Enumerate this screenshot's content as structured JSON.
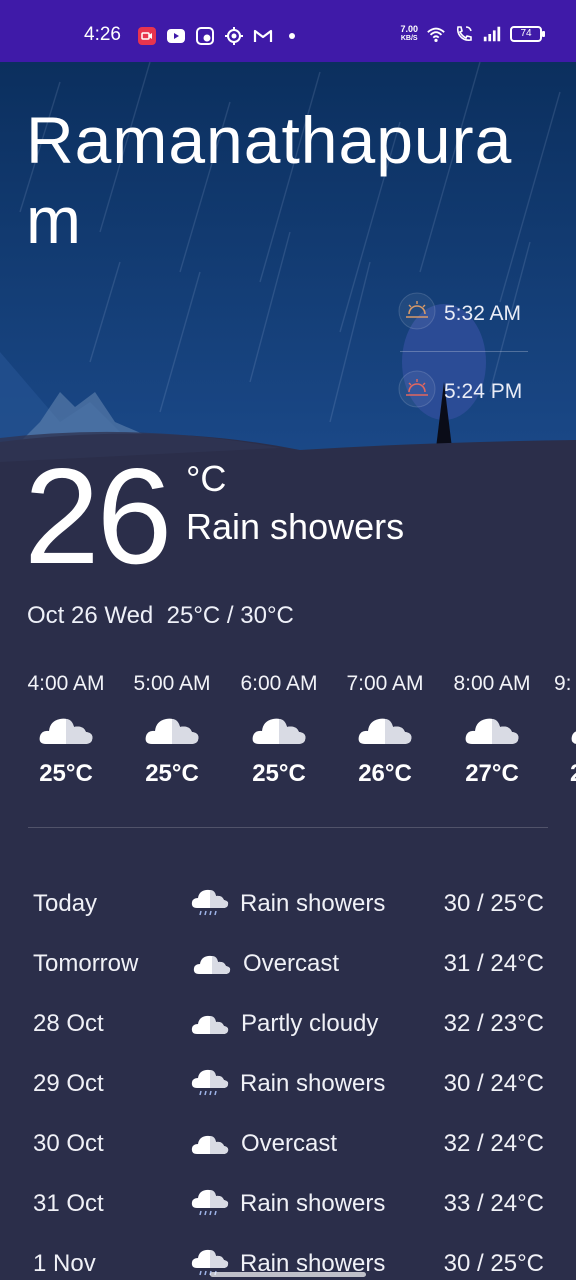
{
  "status_bar": {
    "time": "4:26",
    "net_speed_value": "7.00",
    "net_speed_unit": "KB/S",
    "battery": "74",
    "notification_icons": [
      "screen-record-icon",
      "youtube-icon",
      "camera-app-icon",
      "location-icon",
      "gmail-icon",
      "dot-icon"
    ],
    "system_icons": [
      "wifi-icon",
      "wifi-calling-icon",
      "signal-icon",
      "battery-icon"
    ]
  },
  "location": {
    "city": "Ramanathapuram"
  },
  "sun": {
    "sunrise": "5:32 AM",
    "sunset": "5:24 PM"
  },
  "current": {
    "temperature": "26",
    "unit": "°C",
    "condition": "Rain showers",
    "date": "Oct 26 Wed",
    "range": "25°C / 30°C"
  },
  "hourly": [
    {
      "time": "4:00 AM",
      "temp": "25°C",
      "icon": "cloud-icon"
    },
    {
      "time": "5:00 AM",
      "temp": "25°C",
      "icon": "cloud-icon"
    },
    {
      "time": "6:00 AM",
      "temp": "25°C",
      "icon": "cloud-icon"
    },
    {
      "time": "7:00 AM",
      "temp": "26°C",
      "icon": "cloud-icon"
    },
    {
      "time": "8:00 AM",
      "temp": "27°C",
      "icon": "cloud-icon"
    },
    {
      "time": "9:",
      "temp": "2",
      "icon": "cloud-icon"
    }
  ],
  "daily": [
    {
      "day": "Today",
      "condition": "Rain showers",
      "temps": "30 / 25°C",
      "icon": "rain-cloud-icon"
    },
    {
      "day": "Tomorrow",
      "condition": "Overcast",
      "temps": "31 / 24°C",
      "icon": "cloud-icon"
    },
    {
      "day": "28 Oct",
      "condition": "Partly cloudy",
      "temps": "32 / 23°C",
      "icon": "cloud-icon"
    },
    {
      "day": "29 Oct",
      "condition": "Rain showers",
      "temps": "30 / 24°C",
      "icon": "rain-cloud-icon"
    },
    {
      "day": "30 Oct",
      "condition": "Overcast",
      "temps": "32 / 24°C",
      "icon": "cloud-icon"
    },
    {
      "day": "31 Oct",
      "condition": "Rain showers",
      "temps": "33 / 24°C",
      "icon": "rain-cloud-icon"
    },
    {
      "day": "1 Nov",
      "condition": "Rain showers",
      "temps": "30 / 25°C",
      "icon": "rain-cloud-icon"
    }
  ],
  "colors": {
    "status_bar": "#3f1aa8",
    "sky_top": "#0b2f5e",
    "sky_bottom": "#1c4b8c",
    "ground": "#2b2e4a",
    "sunrise_icon": "#d79a6a",
    "sunset_icon": "#e2675f"
  }
}
